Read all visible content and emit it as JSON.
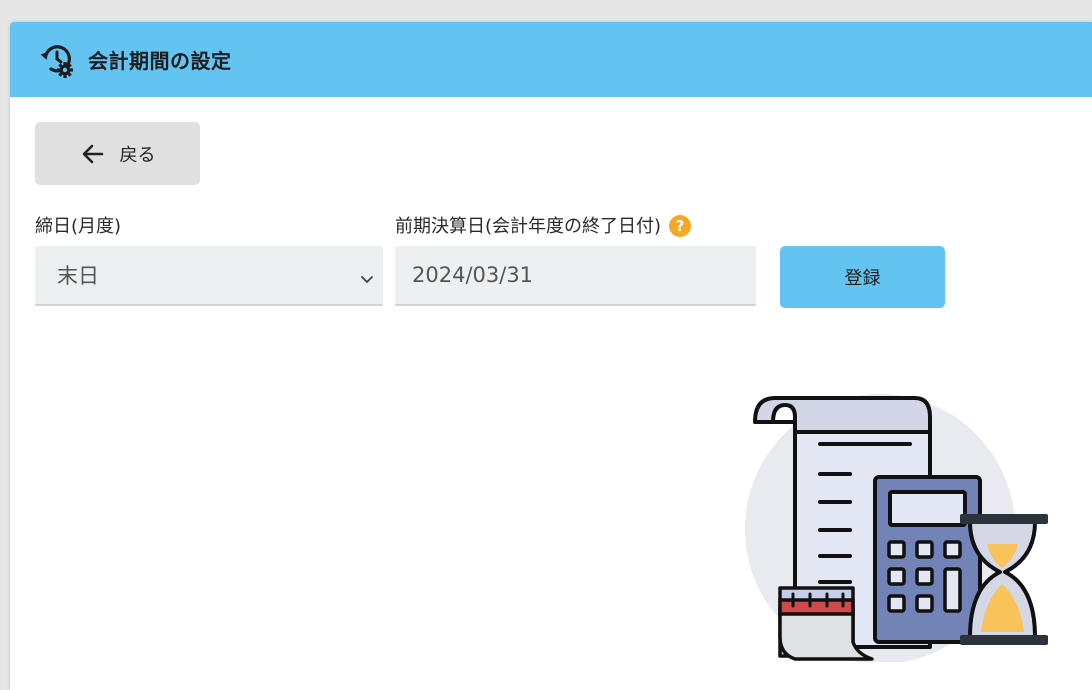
{
  "header": {
    "title": "会計期間の設定",
    "icon": "history-gear-icon",
    "color": "#64c4f1"
  },
  "back_button": {
    "label": "戻る",
    "icon": "arrow-left-icon"
  },
  "closing_day": {
    "label": "締日(月度)",
    "selected": "末日"
  },
  "previous_closing_date": {
    "label": "前期決算日(会計年度の終了日付)",
    "value": "2024/03/31",
    "help_icon": "question-circle-icon"
  },
  "submit_button": {
    "label": "登録"
  },
  "illustration": {
    "icons": [
      "receipt-icon",
      "calculator-icon",
      "hourglass-icon",
      "calendar-icon"
    ]
  }
}
